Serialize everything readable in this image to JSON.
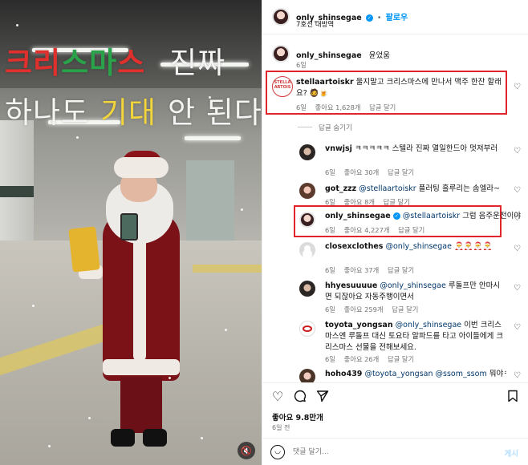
{
  "media": {
    "overlay_line1_red_a": "크리",
    "overlay_line1_green": "스마",
    "overlay_line1_red_b": "스",
    "overlay_line1_white": "진짜",
    "overlay_line2_white_a": "하나도",
    "overlay_line2_yellow": "기대",
    "overlay_line2_white_b": "안 된다",
    "mute_icon": "speaker-mute-icon"
  },
  "header": {
    "username": "only_shinsegae",
    "verified_icon": "verified-badge-icon",
    "separator": "•",
    "follow_label": "팔로우",
    "location": "7호선 내방역"
  },
  "caption": {
    "username": "only_shinsegae",
    "text": "윤었움",
    "time": "6일"
  },
  "comments": [
    {
      "username": "stellaartoiskr",
      "avatar_text": "STELLA ARTOIS",
      "text": "울지말고 크리스마스에 만나서 맥주 한잔 할래요? 🧔🍺",
      "time": "6일",
      "likes": "좋아요 1,628개",
      "reply_label": "답글 달기"
    }
  ],
  "replies_toggle": "답글 숨기기",
  "replies": [
    {
      "username": "vnwjsj",
      "mention": "",
      "text": "ㅋㅋㅋㅋㅋ 스텔라 진짜 열일한드아 멋져부러",
      "time": "6일",
      "likes": "좋아요 30개",
      "reply_label": "답글 달기"
    },
    {
      "username": "got_zzz",
      "mention": "@stellaartoiskr",
      "text": "플러팅 흘루리는 솜엘라~",
      "time": "6일",
      "likes": "좋아요 8개",
      "reply_label": "답글 달기"
    },
    {
      "username": "only_shinsegae",
      "mention": "@stellaartoiskr",
      "text": "그럼 음주운전이야",
      "time": "6일",
      "likes": "좋아요 4,227개",
      "reply_label": "답글 달기"
    },
    {
      "username": "closexclothes",
      "mention": "@only_shinsegae",
      "text": "🎅🎅🎅🎅",
      "time": "6일",
      "likes": "좋아요 37개",
      "reply_label": "답글 달기"
    },
    {
      "username": "hhyesuuuue",
      "mention": "@only_shinsegae",
      "text": "루돌프만 안마시면 되잖아요 자동주행이면서",
      "time": "6일",
      "likes": "좋아요 259개",
      "reply_label": "답글 달기"
    },
    {
      "username": "toyota_yongsan",
      "mention": "@only_shinsegae",
      "text": "이번 크리스마스엔 루돌프 대신 토요타 알파드를 타고 아이들에게 크리스마스 선물을 전해보세요.",
      "time": "6일",
      "likes": "좋아요 26개",
      "reply_label": "답글 달기"
    },
    {
      "username": "hoho439",
      "mention": "@toyota_yongsan @ssom_ssom",
      "text": "뭐야ㅋㅋㅋ",
      "time": "",
      "likes": "",
      "reply_label": ""
    }
  ],
  "actions": {
    "like_icon": "heart-icon",
    "comment_icon": "comment-icon",
    "share_icon": "share-icon",
    "save_icon": "bookmark-icon",
    "likes_count": "좋아요 9.8만개",
    "post_time": "6일 전"
  },
  "comment_input": {
    "emoji_icon": "emoji-icon",
    "placeholder": "댓글 달기...",
    "post_label": "게시"
  },
  "colors": {
    "accent": "#0095f6",
    "highlight": "#e0262a",
    "mention": "#00376b"
  }
}
